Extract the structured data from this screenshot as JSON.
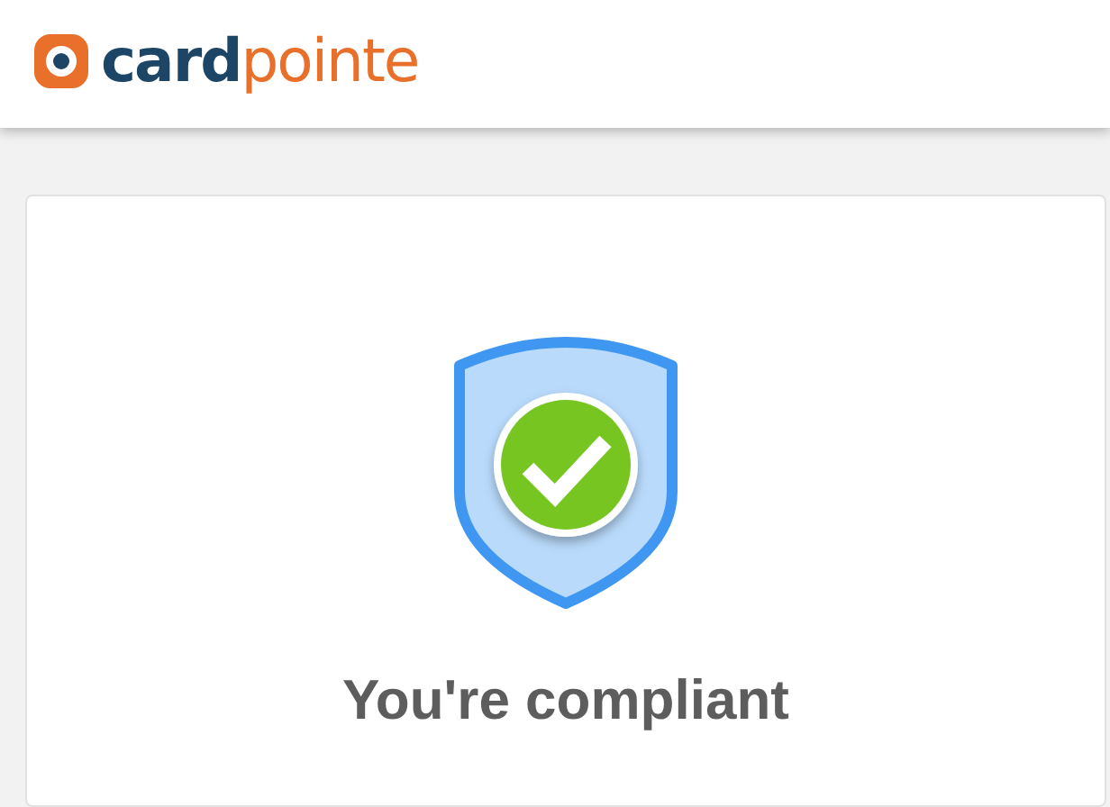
{
  "header": {
    "logo": "**card**pointe"
  },
  "status": {
    "title": "You're compliant"
  }
}
